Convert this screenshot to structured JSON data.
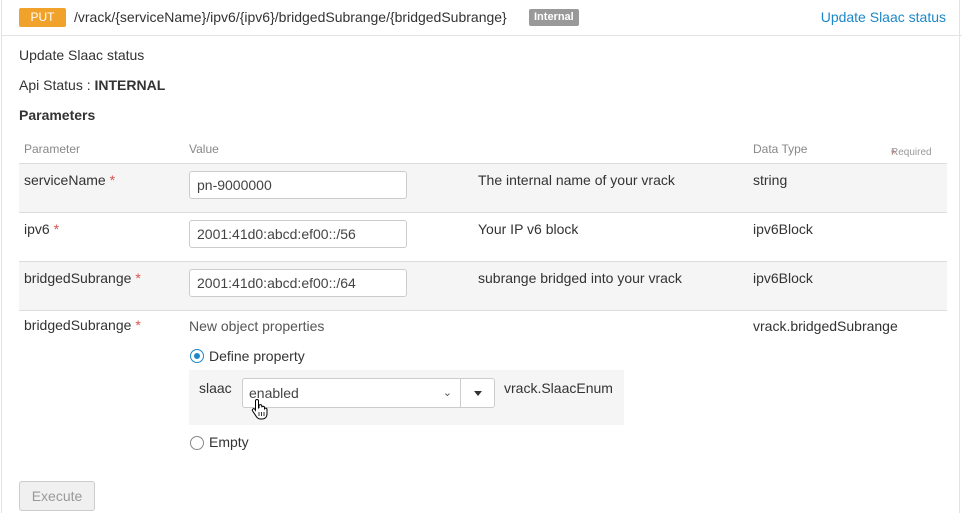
{
  "header": {
    "method": "PUT",
    "path": "/vrack/{serviceName}/ipv6/{ipv6}/bridgedSubrange/{bridgedSubrange}",
    "badge": "Internal",
    "link": "Update Slaac status"
  },
  "description": "Update Slaac status",
  "api_status_label": "Api Status : ",
  "api_status_value": "INTERNAL",
  "parameters_title": "Parameters",
  "columns": {
    "parameter": "Parameter",
    "value": "Value",
    "data_type": "Data Type",
    "required": "Required",
    "required_star": "*"
  },
  "rows": [
    {
      "name": "serviceName",
      "star": "*",
      "value": "pn-9000000",
      "desc": "The internal name of your vrack",
      "type": "string"
    },
    {
      "name": "ipv6",
      "star": "*",
      "value": "2001:41d0:abcd:ef00::/56",
      "desc": "Your IP v6 block",
      "type": "ipv6Block"
    },
    {
      "name": "bridgedSubrange",
      "star": "*",
      "value": "2001:41d0:abcd:ef00::/64",
      "desc": "subrange bridged into your vrack",
      "type": "ipv6Block"
    }
  ],
  "body_param": {
    "name": "bridgedSubrange",
    "star": "*",
    "hint": "New object properties",
    "type": "vrack.bridgedSubrange",
    "define_label": "Define property",
    "empty_label": "Empty",
    "field_label": "slaac",
    "field_value": "enabled",
    "field_type": "vrack.SlaacEnum"
  },
  "execute_label": "Execute",
  "colors": {
    "put": "#f0a22b",
    "link": "#1c87c9",
    "required": "#d9534f",
    "badge": "#999999"
  }
}
